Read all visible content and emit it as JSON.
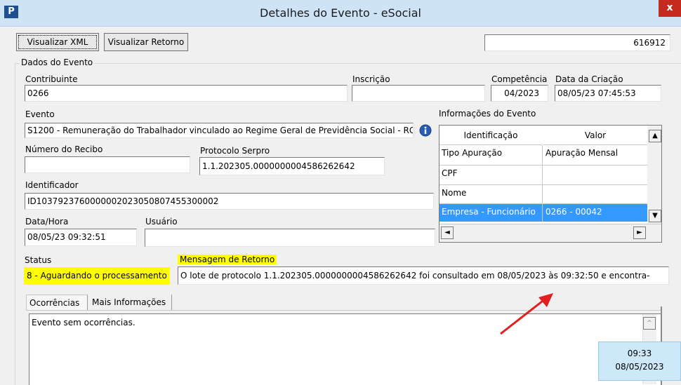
{
  "window": {
    "title": "Detalhes do Evento - eSocial",
    "app_icon": "P",
    "close": "x"
  },
  "toolbar": {
    "visualizar_xml": "Visualizar XML",
    "visualizar_retorno": "Visualizar Retorno",
    "id_value": "616912"
  },
  "group": {
    "title": "Dados do Evento"
  },
  "contribuinte": {
    "label": "Contribuinte",
    "value": "0266"
  },
  "inscricao": {
    "label": "Inscrição",
    "value": ""
  },
  "competencia": {
    "label": "Competência",
    "value": "04/2023"
  },
  "data_criacao": {
    "label": "Data da Criação",
    "value": "08/05/23 07:45:53"
  },
  "evento": {
    "label": "Evento",
    "value": "S1200 - Remuneração do Trabalhador vinculado ao Regime Geral de Previdência Social - RG"
  },
  "numero_recibo": {
    "label": "Número do Recibo",
    "value": ""
  },
  "protocolo_serpro": {
    "label": "Protocolo Serpro",
    "value": "1.1.202305.0000000004586262642"
  },
  "identificador": {
    "label": "Identificador",
    "value": "ID1037923760000002023050807455300002"
  },
  "data_hora": {
    "label": "Data/Hora",
    "value": "08/05/23 09:32:51"
  },
  "usuario": {
    "label": "Usuário",
    "value": ""
  },
  "status": {
    "label": "Status",
    "value": "8 - Aguardando o processamento"
  },
  "mensagem": {
    "label": "Mensagem de Retorno",
    "value": "O lote de protocolo 1.1.202305.0000000004586262642 foi consultado em 08/05/2023 às 09:32:50 e encontra-"
  },
  "info_evento": {
    "label": "Informações do Evento",
    "headers": [
      "Identificação",
      "Valor"
    ],
    "rows": [
      {
        "id": "Tipo Apuração",
        "valor": "Apuração Mensal"
      },
      {
        "id": "CPF",
        "valor": ""
      },
      {
        "id": "Nome",
        "valor": ""
      },
      {
        "id": "Empresa - Funcionário",
        "valor": "0266 - 00042"
      }
    ],
    "selected_row": "Empresa - Funcionário"
  },
  "tabs": {
    "ocorrencias": "Ocorrências",
    "mais_informacoes": "Mais Informações"
  },
  "ocorrencias_text": "Evento sem ocorrências.",
  "clock": {
    "time": "09:33",
    "date": "08/05/2023"
  },
  "colors": {
    "highlight": "#ffff00",
    "selection": "#3399ff",
    "arrow": "#e02020"
  }
}
